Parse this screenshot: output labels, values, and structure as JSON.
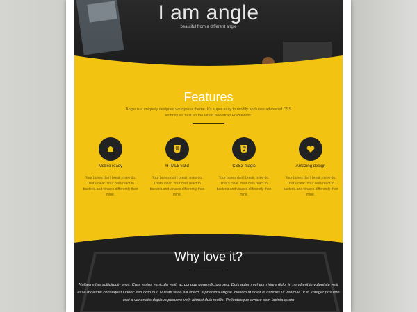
{
  "hero": {
    "title": "I am angle",
    "subtitle": "beautiful from a different angle"
  },
  "features_section": {
    "title": "Features",
    "description": "Angle is a uniquely designed wordpress theme. It's super easy to modify and uses advanced CSS techniques built on the latest Bootstrap Framework.",
    "items": [
      {
        "icon": "android-icon",
        "name": "Mobile ready",
        "text": "Your bones don't break, mine do. That's clear. Your cells react to bacteria and viruses differently than mine."
      },
      {
        "icon": "html5-icon",
        "name": "HTML5 valid",
        "text": "Your bones don't break, mine do. That's clear. Your cells react to bacteria and viruses differently than mine."
      },
      {
        "icon": "css3-icon",
        "name": "CSS3 magic",
        "text": "Your bones don't break, mine do. That's clear. Your cells react to bacteria and viruses differently than mine."
      },
      {
        "icon": "heart-icon",
        "name": "Amazing design",
        "text": "Your bones don't break, mine do. That's clear. Your cells react to bacteria and viruses differently than mine."
      }
    ]
  },
  "why_section": {
    "title": "Why love it?",
    "text": "Nullam vitae sollicitudin eros. Cras varius vehicula velit, ac congue quam dictum sed. Duis autem vel eum iriure dolor in hendrerit in vulputate velit esse molestie consequat.Donec sed odio dui. Nullam vitae elit libero, a pharetra augue. Nullam id dolor id ultricies ut vehicula ut id. Integer posuere erat a venenatis dapibus posuere velit aliquet duis mollis. Pellentesque ornare sem lacinia quam"
  },
  "colors": {
    "accent": "#f3c312",
    "dark": "#1b1b1b"
  }
}
